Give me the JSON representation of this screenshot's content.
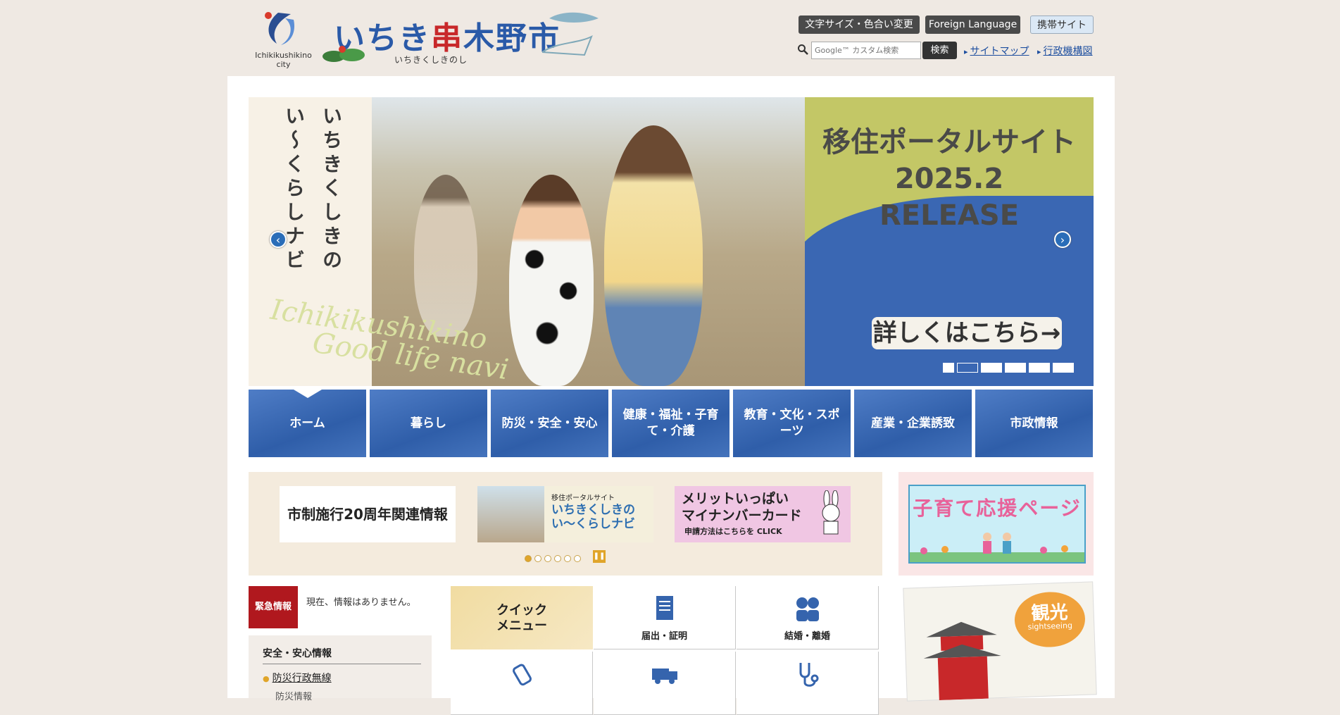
{
  "header": {
    "logo_text": "Ichikikushikino city",
    "site_title_pre": "いちき",
    "site_title_red": "串",
    "site_title_post": "木野市",
    "site_title_kana": "いちきくしきのし",
    "font_button": "文字サイズ・色合い変更",
    "foreign_button": "Foreign Language",
    "mobile_button": "携帯サイト",
    "search_placeholder": "Google™ カスタム検索",
    "search_button": "検索",
    "sitemap_link": "サイトマップ",
    "org_link": "行政機構図"
  },
  "hero": {
    "vertical_1": "いちきくしきの",
    "vertical_2": "い〜くらしナビ",
    "script_1": "Ichikikushikino",
    "script_2": "Good life navi",
    "headline_1": "移住ポータルサイト",
    "headline_2": "2025.2",
    "headline_3": "RELEASE",
    "cta": "詳しくはこちら→",
    "prev_icon": "chevron-left-icon",
    "next_icon": "chevron-right-icon"
  },
  "nav": {
    "items": [
      "ホーム",
      "暮らし",
      "防災・安全・安心",
      "健康・福祉・子育て・介護",
      "教育・文化・スポーツ",
      "産業・企業誘致",
      "市政情報"
    ]
  },
  "banners": {
    "b1": "市制施行20周年関連情報",
    "b2_small": "移住ポータルサイト",
    "b2_main": "いちきくしきの\nい〜くらしナビ",
    "b3_main": "メリットいっぱい\nマイナンバーカード",
    "b3_sub": "申請方法はこちらを CLICK",
    "kosodate": "子育て応援ページ"
  },
  "emergency": {
    "badge": "緊急情報",
    "text": "現在、情報はありません。"
  },
  "safety": {
    "heading": "安全・安心情報",
    "link1": "防災行政無線",
    "link2": "防災情報"
  },
  "quick": {
    "title_1": "クイック",
    "title_2": "メニュー",
    "todoke": "届出・証明",
    "kekkon": "結婚・離婚"
  },
  "kanko": {
    "label": "観光",
    "sub": "sightseeing"
  },
  "colors": {
    "nav_blue": "#2f5ea9",
    "emergency_red": "#b0181e",
    "accent_orange": "#e0a52a"
  }
}
